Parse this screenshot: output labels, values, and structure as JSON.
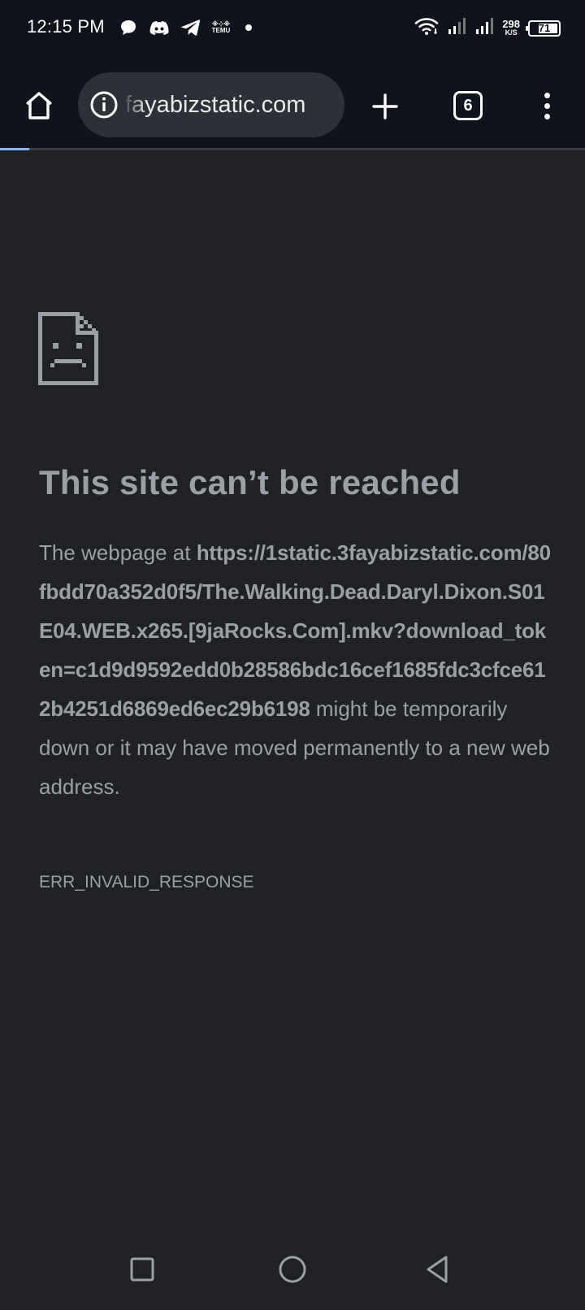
{
  "status_bar": {
    "time": "12:15 PM",
    "notification_icons": [
      "chat-bubble-icon",
      "discord-icon",
      "telegram-icon",
      "temu-icon",
      "dot-icon"
    ],
    "temu_label": "TEMU",
    "net_speed_value": "298",
    "net_speed_unit": "K/S",
    "battery_percent": "71",
    "battery_level": 0.71
  },
  "toolbar": {
    "url_display": "fayabizstatic.com",
    "tab_count": "6",
    "load_progress": 0.05
  },
  "error_page": {
    "title": "This site can’t be reached",
    "intro": "The webpage at ",
    "url": "https://1static.3fayabizstatic.com/80fbdd70a352d0f5/The.Walking.Dead.Daryl.Dixon.S01E04.WEB.x265.[9jaRocks.Com].mkv?download_token=c1d9d9592edd0b28586bdc16cef1685fdc3cfce612b4251d6869ed6ec29b6198",
    "description": " might be temporarily down or it may have moved permanently to a new web address.",
    "error_code": "ERR_INVALID_RESPONSE"
  },
  "nav_bar": {
    "buttons": [
      "recents-square-icon",
      "home-circle-icon",
      "back-triangle-icon"
    ]
  },
  "colors": {
    "background": "#202124",
    "toolbar": "#0f131b",
    "omnibox": "#2d3036",
    "text_secondary": "#9aa0a6",
    "progress": "#8ab4f8"
  }
}
